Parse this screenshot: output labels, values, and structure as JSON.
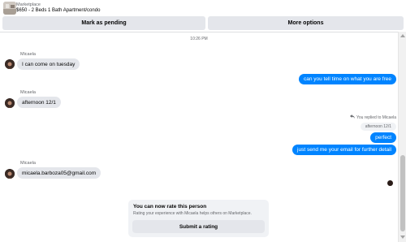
{
  "header": {
    "source": "Marketplace",
    "listing_title": "$650 - 2 Beds 1 Bath Apartment/condo"
  },
  "actions": {
    "pending_label": "Mark as pending",
    "more_label": "More options"
  },
  "conversation": {
    "timestamp": "10:26 PM",
    "sender_name": "Micaela",
    "reply_notice": "You replied to Micaela",
    "quoted_message": "afternoon 12/1",
    "messages_in": [
      "I can come on tuesday",
      "afternoon 12/1",
      "micaela.barboza05@gmail.com"
    ],
    "messages_out": [
      "can you tell time on what you are free",
      "perfect",
      "just send me your email for further detail"
    ]
  },
  "rating": {
    "title": "You can now rate this person",
    "description": "Rating your experience with Micaela helps others on Marketplace.",
    "button_label": "Submit a rating"
  },
  "colors": {
    "outgoing_bubble": "#0084ff",
    "incoming_bubble": "#e4e6eb",
    "button_bg": "#e4e6eb"
  }
}
